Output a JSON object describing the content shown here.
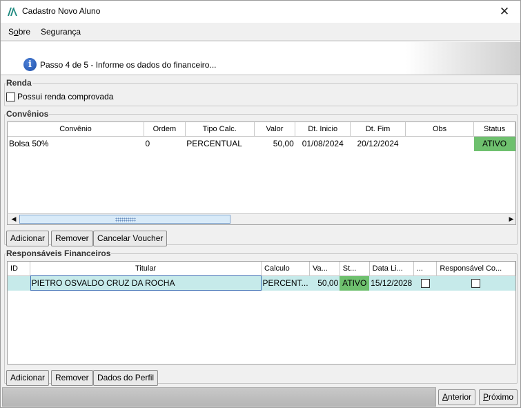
{
  "window": {
    "title": "Cadastro Novo Aluno",
    "close_glyph": "✕"
  },
  "menu": {
    "sobre": {
      "before": "S",
      "underlined": "o",
      "after": "bre"
    },
    "seguranca": "Segurança"
  },
  "step": {
    "icon": "info-icon",
    "text": "Passo 4 de 5 - Informe os dados do financeiro..."
  },
  "renda": {
    "title": "Renda",
    "checkbox_label": "Possui renda comprovada",
    "checked": false
  },
  "convenios": {
    "title": "Convênios",
    "columns": [
      "Convênio",
      "Ordem",
      "Tipo Calc.",
      "Valor",
      "Dt. Inicio",
      "Dt. Fim",
      "Obs",
      "Status"
    ],
    "rows": [
      {
        "convenio": "Bolsa 50%",
        "ordem": "0",
        "tipo": "PERCENTUAL",
        "valor": "50,00",
        "dt_inicio": "01/08/2024",
        "dt_fim": "20/12/2024",
        "obs": "",
        "status": "ATIVO"
      }
    ],
    "buttons": {
      "adicionar": "Adicionar",
      "remover": "Remover",
      "cancelar": "Cancelar Voucher"
    }
  },
  "responsaveis": {
    "title": "Responsáveis Financeiros",
    "columns": [
      "ID",
      "Titular",
      "Calculo",
      "Va...",
      "St...",
      "Data Li...",
      "...",
      "Responsável Co..."
    ],
    "rows": [
      {
        "id": "",
        "titular": "PIETRO OSVALDO CRUZ DA ROCHA",
        "calculo": "PERCENT...",
        "valor": "50,00",
        "status": "ATIVO",
        "data_limite": "15/12/2028",
        "flag1": false,
        "flag2": false
      }
    ],
    "buttons": {
      "adicionar": "Adicionar",
      "remover": "Remover",
      "perfil": "Dados do Perfil"
    }
  },
  "footer": {
    "anterior": {
      "underlined": "A",
      "rest": "nterior"
    },
    "proximo": {
      "underlined": "P",
      "rest": "róximo"
    }
  },
  "colors": {
    "status_ativo": "#6ec06e",
    "selected_row": "#c6eaea",
    "info_icon": "#1d4ea8"
  }
}
